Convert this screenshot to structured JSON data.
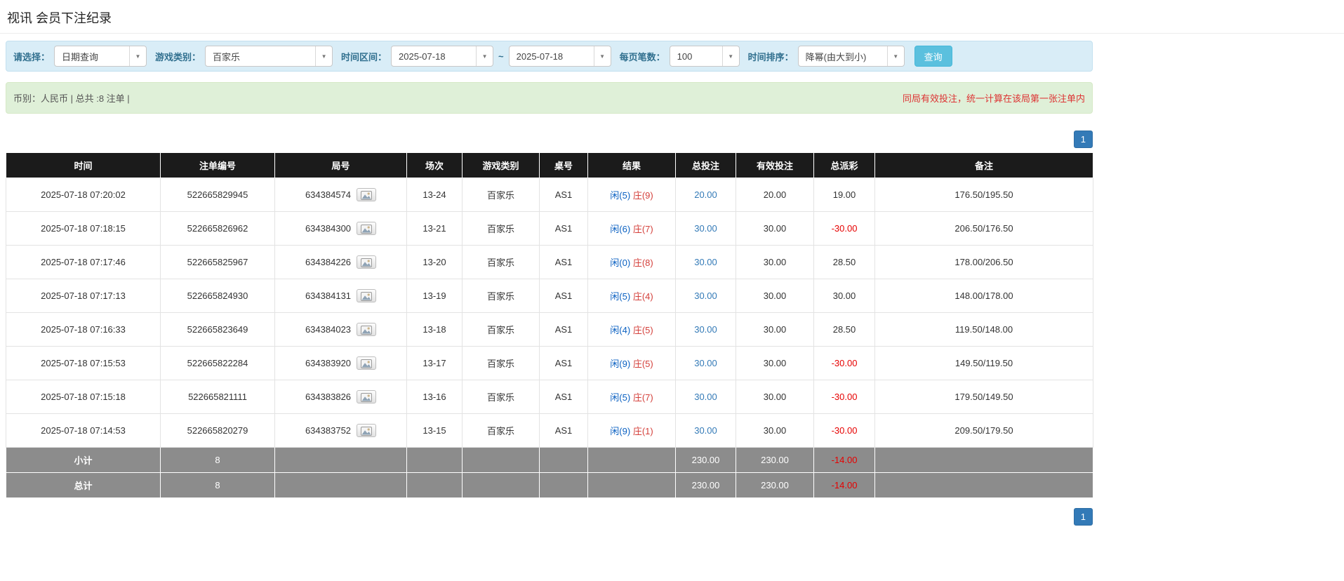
{
  "page": {
    "title": "视讯 会员下注纪录"
  },
  "filters": {
    "select_label": "请选择：",
    "select_value": "日期查询",
    "game_label": "游戏类别：",
    "game_value": "百家乐",
    "range_label": "时间区间：",
    "date_from": "2025-07-18",
    "range_separator": "~",
    "date_to": "2025-07-18",
    "page_size_label": "每页笔数：",
    "page_size_value": "100",
    "sort_label": "时间排序：",
    "sort_value": "降幂(由大到小)",
    "search_button": "查询"
  },
  "summary_bar": {
    "left": "币别：人民币 | 总共 :8 注单 |",
    "right": "同局有效投注，统一计算在该局第一张注单内"
  },
  "pagination": {
    "page": "1"
  },
  "colors": {
    "accent_blue": "#337ab7",
    "player_blue": "#0b61c2",
    "banker_red": "#d43f3a",
    "negative_red": "#e60000",
    "header_bg": "#1b1b1b",
    "summary_row_bg": "#8c8c8c",
    "filter_bar_bg": "#d9edf7",
    "info_bar_bg": "#dff0d8",
    "search_button_bg": "#5bc0de"
  },
  "table": {
    "headers": [
      "时间",
      "注单编号",
      "局号",
      "场次",
      "游戏类别",
      "桌号",
      "结果",
      "总投注",
      "有效投注",
      "总派彩",
      "备注"
    ],
    "rows": [
      {
        "time": "2025-07-18 07:20:02",
        "bet_id": "522665829945",
        "round": "634384574",
        "session": "13-24",
        "game": "百家乐",
        "table_no": "AS1",
        "player": "闲(5)",
        "banker": "庄(9)",
        "total_bet": "20.00",
        "valid_bet": "20.00",
        "payout": "19.00",
        "remark": "176.50/195.50"
      },
      {
        "time": "2025-07-18 07:18:15",
        "bet_id": "522665826962",
        "round": "634384300",
        "session": "13-21",
        "game": "百家乐",
        "table_no": "AS1",
        "player": "闲(6)",
        "banker": "庄(7)",
        "total_bet": "30.00",
        "valid_bet": "30.00",
        "payout": "-30.00",
        "remark": "206.50/176.50"
      },
      {
        "time": "2025-07-18 07:17:46",
        "bet_id": "522665825967",
        "round": "634384226",
        "session": "13-20",
        "game": "百家乐",
        "table_no": "AS1",
        "player": "闲(0)",
        "banker": "庄(8)",
        "total_bet": "30.00",
        "valid_bet": "30.00",
        "payout": "28.50",
        "remark": "178.00/206.50"
      },
      {
        "time": "2025-07-18 07:17:13",
        "bet_id": "522665824930",
        "round": "634384131",
        "session": "13-19",
        "game": "百家乐",
        "table_no": "AS1",
        "player": "闲(5)",
        "banker": "庄(4)",
        "total_bet": "30.00",
        "valid_bet": "30.00",
        "payout": "30.00",
        "remark": "148.00/178.00"
      },
      {
        "time": "2025-07-18 07:16:33",
        "bet_id": "522665823649",
        "round": "634384023",
        "session": "13-18",
        "game": "百家乐",
        "table_no": "AS1",
        "player": "闲(4)",
        "banker": "庄(5)",
        "total_bet": "30.00",
        "valid_bet": "30.00",
        "payout": "28.50",
        "remark": "119.50/148.00"
      },
      {
        "time": "2025-07-18 07:15:53",
        "bet_id": "522665822284",
        "round": "634383920",
        "session": "13-17",
        "game": "百家乐",
        "table_no": "AS1",
        "player": "闲(9)",
        "banker": "庄(5)",
        "total_bet": "30.00",
        "valid_bet": "30.00",
        "payout": "-30.00",
        "remark": "149.50/119.50"
      },
      {
        "time": "2025-07-18 07:15:18",
        "bet_id": "522665821111",
        "round": "634383826",
        "session": "13-16",
        "game": "百家乐",
        "table_no": "AS1",
        "player": "闲(5)",
        "banker": "庄(7)",
        "total_bet": "30.00",
        "valid_bet": "30.00",
        "payout": "-30.00",
        "remark": "179.50/149.50"
      },
      {
        "time": "2025-07-18 07:14:53",
        "bet_id": "522665820279",
        "round": "634383752",
        "session": "13-15",
        "game": "百家乐",
        "table_no": "AS1",
        "player": "闲(9)",
        "banker": "庄(1)",
        "total_bet": "30.00",
        "valid_bet": "30.00",
        "payout": "-30.00",
        "remark": "209.50/179.50"
      }
    ],
    "subtotal": {
      "label": "小计",
      "count": "8",
      "total_bet": "230.00",
      "valid_bet": "230.00",
      "payout": "-14.00"
    },
    "total": {
      "label": "总计",
      "count": "8",
      "total_bet": "230.00",
      "valid_bet": "230.00",
      "payout": "-14.00"
    }
  }
}
